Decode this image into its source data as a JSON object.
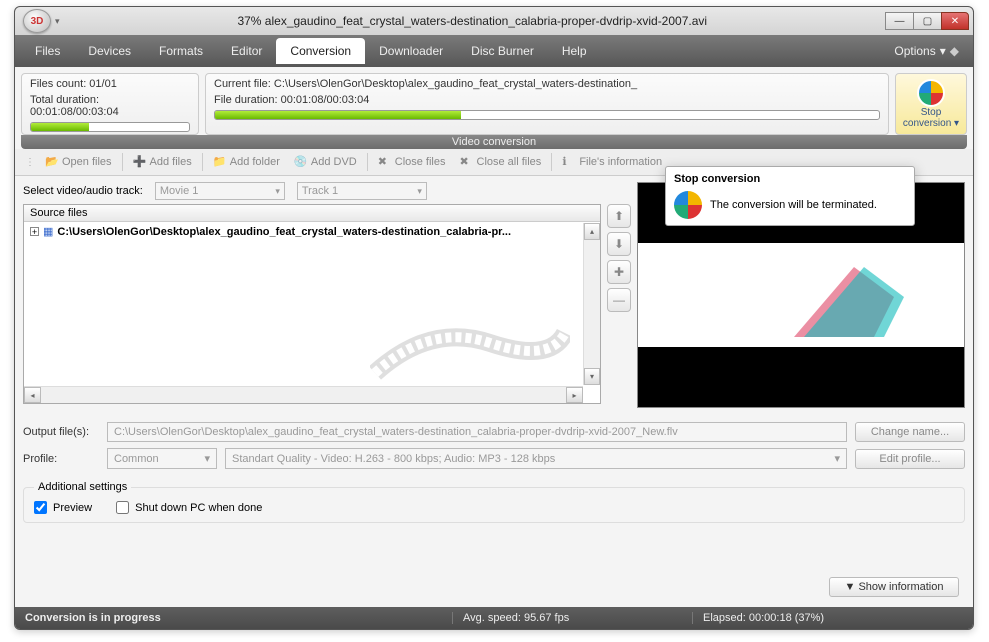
{
  "titlebar": {
    "title": "37% alex_gaudino_feat_crystal_waters-destination_calabria-proper-dvdrip-xvid-2007.avi"
  },
  "menubar": {
    "tabs": [
      "Files",
      "Devices",
      "Formats",
      "Editor",
      "Conversion",
      "Downloader",
      "Disc Burner",
      "Help"
    ],
    "active_index": 4,
    "options_label": "Options"
  },
  "summary": {
    "files_count_label": "Files count: 01/01",
    "total_duration_label": "Total duration: 00:01:08/00:03:04",
    "current_file_label": "Current file: C:\\Users\\OlenGor\\Desktop\\alex_gaudino_feat_crystal_waters-destination_",
    "file_duration_label": "File duration: 00:01:08/00:03:04",
    "overall_progress_pct": 37,
    "file_progress_pct": 37,
    "video_conversion_label": "Video conversion"
  },
  "stop_button": {
    "line1": "Stop",
    "line2": "conversion"
  },
  "toolbar2": {
    "open_files": "Open files",
    "add_files": "Add files",
    "add_folder": "Add folder",
    "add_dvd": "Add DVD",
    "close_files": "Close files",
    "close_all": "Close all files",
    "file_info": "File's information"
  },
  "tracks": {
    "label": "Select video/audio track:",
    "movie": "Movie 1",
    "track": "Track 1"
  },
  "source": {
    "header": "Source files",
    "item": "C:\\Users\\OlenGor\\Desktop\\alex_gaudino_feat_crystal_waters-destination_calabria-pr..."
  },
  "tooltip": {
    "title": "Stop conversion",
    "body": "The conversion will be terminated."
  },
  "output": {
    "label": "Output file(s):",
    "path": "C:\\Users\\OlenGor\\Desktop\\alex_gaudino_feat_crystal_waters-destination_calabria-proper-dvdrip-xvid-2007_New.flv",
    "change_name": "Change name..."
  },
  "profile": {
    "label": "Profile:",
    "preset": "Common",
    "desc": "Standart Quality - Video: H.263 - 800 kbps; Audio: MP3 - 128 kbps",
    "edit": "Edit profile..."
  },
  "additional": {
    "legend": "Additional settings",
    "preview": "Preview",
    "shutdown": "Shut down PC when done",
    "show_info": "▼ Show information"
  },
  "status": {
    "progress": "Conversion is in progress",
    "avg_speed": "Avg. speed: 95.67 fps",
    "elapsed": "Elapsed: 00:00:18 (37%)"
  }
}
